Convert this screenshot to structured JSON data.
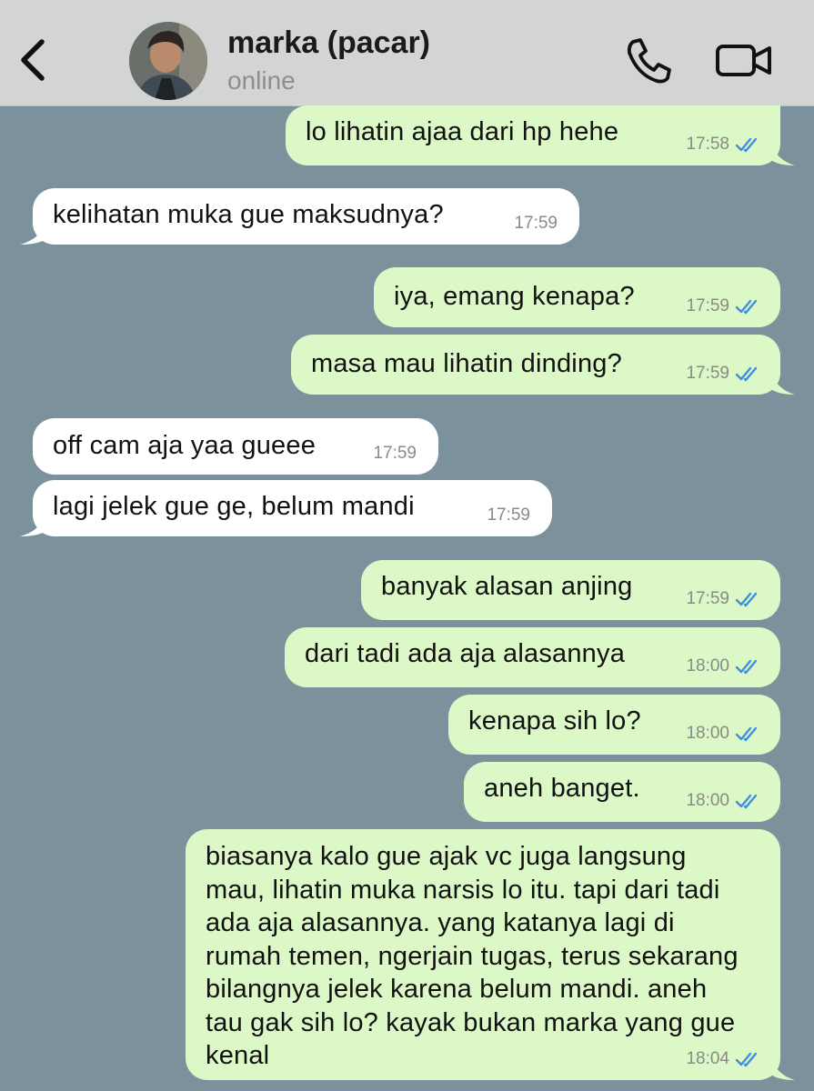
{
  "header": {
    "contact_name": "marka (pacar)",
    "status": "online",
    "icons": [
      "chevron-left-icon",
      "avatar",
      "phone-icon",
      "video-camera-icon"
    ]
  },
  "colors": {
    "chat_background": "#7b929c",
    "header_background": "#d2d5d4",
    "outgoing_bubble": "#dcf8c6",
    "incoming_bubble": "#ffffff",
    "read_ticks": "#3f8ee0"
  },
  "messages": [
    {
      "dir": "out",
      "text": "lo lihatin ajaa dari hp hehe",
      "time": "17:58",
      "read": true
    },
    {
      "dir": "in",
      "text": "kelihatan muka gue maksudnya?",
      "time": "17:59"
    },
    {
      "dir": "out",
      "text": "iya, emang kenapa?",
      "time": "17:59",
      "read": true
    },
    {
      "dir": "out",
      "text": "masa mau lihatin dinding?",
      "time": "17:59",
      "read": true
    },
    {
      "dir": "in",
      "text": "off cam aja yaa gueee",
      "time": "17:59"
    },
    {
      "dir": "in",
      "text": "lagi jelek gue ge, belum mandi",
      "time": "17:59"
    },
    {
      "dir": "out",
      "text": "banyak alasan anjing",
      "time": "17:59",
      "read": true
    },
    {
      "dir": "out",
      "text": "dari tadi ada aja alasannya",
      "time": "18:00",
      "read": true
    },
    {
      "dir": "out",
      "text": "kenapa sih lo?",
      "time": "18:00",
      "read": true
    },
    {
      "dir": "out",
      "text": "aneh banget.",
      "time": "18:00",
      "read": true
    },
    {
      "dir": "out",
      "text": "biasanya kalo gue ajak vc juga langsung mau, lihatin muka narsis lo itu. tapi dari tadi ada aja alasannya. yang katanya lagi di rumah temen, ngerjain tugas, terus sekarang bilangnya jelek karena belum mandi. aneh tau gak sih lo? kayak bukan marka yang gue kenal",
      "time": "18:04",
      "read": true
    }
  ]
}
